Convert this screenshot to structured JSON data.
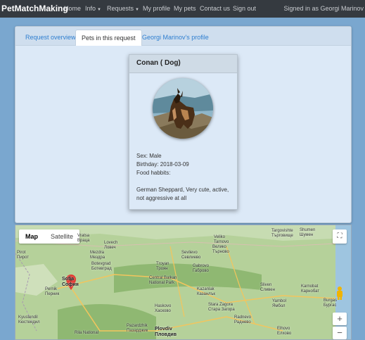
{
  "navbar": {
    "brand": "PetMatchMaking",
    "links": [
      "Home",
      "Info",
      "Requests",
      "My profile",
      "My pets",
      "Contact us",
      "Sign out"
    ],
    "signed_in": "Signed in as Georgi Marinov"
  },
  "tabs": [
    "Request overview",
    "Pets in this request",
    "Georgi Marinov's profile"
  ],
  "active_tab": "Pets in this request",
  "pet": {
    "title": "Conan ( Dog)",
    "sex": "Sex: Male",
    "birthday": "Birthday: 2018-03-09",
    "habbits_label": "Food habbits:",
    "description_1": "German Sheppard, Very cute, active,",
    "description_2": "not aggressive at all"
  },
  "map": {
    "map_label": "Map",
    "satellite_label": "Satellite",
    "zoom_in": "+",
    "zoom_out": "−",
    "places": [
      {
        "l1": "Lovech",
        "l2": "Ловеч"
      },
      {
        "l1": "Veliko",
        "l2": "Tarnovo"
      },
      {
        "l1": "Велико",
        "l2": "Търново"
      },
      {
        "l1": "Targovishte",
        "l2": "Търговище"
      },
      {
        "l1": "Shumen",
        "l2": "Шумен"
      },
      {
        "l1": "Vratsa",
        "l2": "Враца"
      },
      {
        "l1": "Sofia",
        "l2": "София"
      },
      {
        "l1": "Pernik",
        "l2": "Перник"
      },
      {
        "l1": "Plovdiv",
        "l2": "Пловдив"
      },
      {
        "l1": "Stara Zagora",
        "l2": "Стара Загора"
      },
      {
        "l1": "Sliven",
        "l2": "Сливен"
      },
      {
        "l1": "Yambol",
        "l2": "Ямбол"
      },
      {
        "l1": "Kazanlak",
        "l2": "Казанлък"
      },
      {
        "l1": "Gabrovo",
        "l2": "Габрово"
      },
      {
        "l1": "Troyan",
        "l2": "Троян"
      },
      {
        "l1": "Botevgrad",
        "l2": "Ботевград"
      },
      {
        "l1": "Pazardzhik",
        "l2": "Пазарджик"
      },
      {
        "l1": "Haskovo",
        "l2": "Хасково"
      },
      {
        "l1": "Kyustendil",
        "l2": "Кюстендил"
      },
      {
        "l1": "Rila National",
        "l2": ""
      },
      {
        "l1": "Central Balkan",
        "l2": "National Park"
      },
      {
        "l1": "Sevlievo",
        "l2": "Севлиево"
      },
      {
        "l1": "Elhovo",
        "l2": "Елхово"
      },
      {
        "l1": "Radnevo",
        "l2": "Раднево"
      },
      {
        "l1": "Karnobat",
        "l2": "Карнобат"
      },
      {
        "l1": "Burgas",
        "l2": "Бургас"
      },
      {
        "l1": "Pirot",
        "l2": "Пирот"
      },
      {
        "l1": "Mezdra",
        "l2": "Мездра"
      }
    ]
  }
}
